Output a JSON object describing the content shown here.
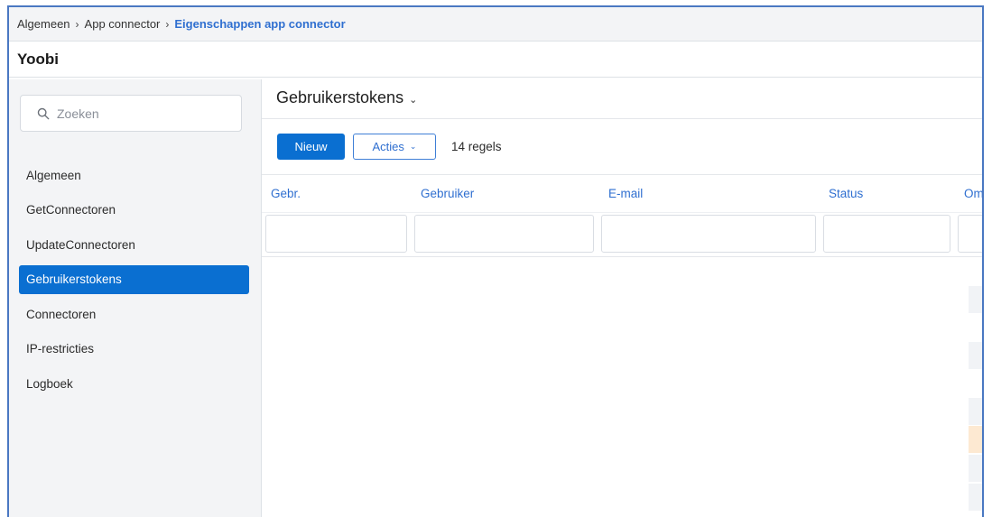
{
  "breadcrumb": {
    "items": [
      "Algemeen",
      "App connector"
    ],
    "current": "Eigenschappen app connector",
    "separator": "›"
  },
  "app": {
    "title": "Yoobi"
  },
  "sidebar": {
    "search_placeholder": "Zoeken",
    "items": [
      {
        "label": "Algemeen",
        "active": false
      },
      {
        "label": "GetConnectoren",
        "active": false
      },
      {
        "label": "UpdateConnectoren",
        "active": false
      },
      {
        "label": "Gebruikerstokens",
        "active": true
      },
      {
        "label": "Connectoren",
        "active": false
      },
      {
        "label": "IP-restricties",
        "active": false
      },
      {
        "label": "Logboek",
        "active": false
      }
    ]
  },
  "main": {
    "title": "Gebruikerstokens",
    "title_chevron": "⌄",
    "toolbar": {
      "new_label": "Nieuw",
      "actions_label": "Acties",
      "actions_chevron": "⌄",
      "row_count": "14 regels"
    },
    "columns": [
      "Gebr.",
      "Gebruiker",
      "E-mail",
      "Status",
      "Oms"
    ]
  },
  "colors": {
    "accent": "#0a6fd1",
    "link": "#2f6fd0",
    "frame": "#4a78c2",
    "sidebar_bg": "#f3f4f6",
    "highlight_row": "#fde9d2"
  }
}
